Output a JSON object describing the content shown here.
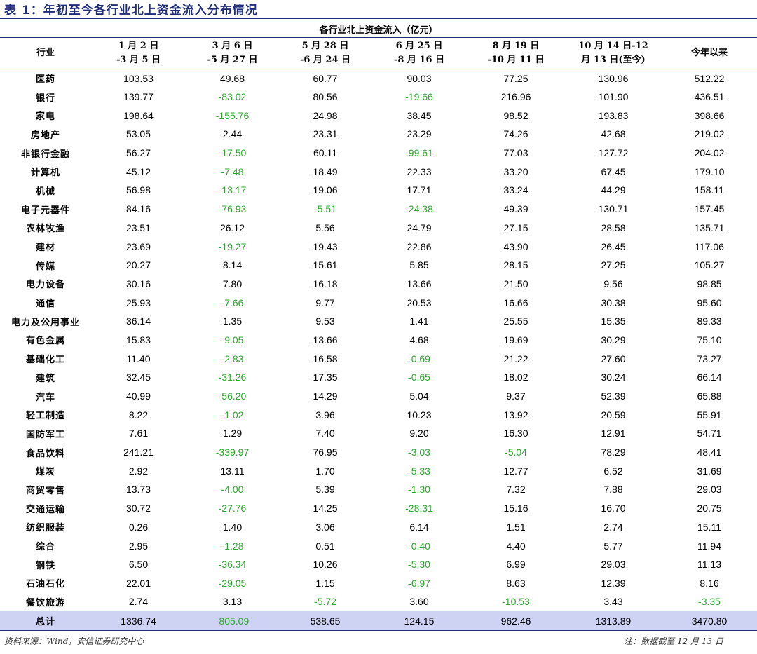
{
  "title": "表 1：年初至今各行业北上资金流入分布情况",
  "super_header": "各行业北上资金流入（亿元）",
  "columns": [
    "行业",
    "1 月 2 日\n-3 月 5 日",
    "3 月 6 日\n-5 月 27 日",
    "5 月 28 日\n-6 月 24 日",
    "6 月 25 日\n-8 月 16 日",
    "8 月 19 日\n-10 月 11 日",
    "10 月 14 日-12\n月 13 日(至今)",
    "今年以来"
  ],
  "rows": [
    [
      "医药",
      "103.53",
      "49.68",
      "60.77",
      "90.03",
      "77.25",
      "130.96",
      "512.22"
    ],
    [
      "银行",
      "139.77",
      "-83.02",
      "80.56",
      "-19.66",
      "216.96",
      "101.90",
      "436.51"
    ],
    [
      "家电",
      "198.64",
      "-155.76",
      "24.98",
      "38.45",
      "98.52",
      "193.83",
      "398.66"
    ],
    [
      "房地产",
      "53.05",
      "2.44",
      "23.31",
      "23.29",
      "74.26",
      "42.68",
      "219.02"
    ],
    [
      "非银行金融",
      "56.27",
      "-17.50",
      "60.11",
      "-99.61",
      "77.03",
      "127.72",
      "204.02"
    ],
    [
      "计算机",
      "45.12",
      "-7.48",
      "18.49",
      "22.33",
      "33.20",
      "67.45",
      "179.10"
    ],
    [
      "机械",
      "56.98",
      "-13.17",
      "19.06",
      "17.71",
      "33.24",
      "44.29",
      "158.11"
    ],
    [
      "电子元器件",
      "84.16",
      "-76.93",
      "-5.51",
      "-24.38",
      "49.39",
      "130.71",
      "157.45"
    ],
    [
      "农林牧渔",
      "23.51",
      "26.12",
      "5.56",
      "24.79",
      "27.15",
      "28.58",
      "135.71"
    ],
    [
      "建材",
      "23.69",
      "-19.27",
      "19.43",
      "22.86",
      "43.90",
      "26.45",
      "117.06"
    ],
    [
      "传媒",
      "20.27",
      "8.14",
      "15.61",
      "5.85",
      "28.15",
      "27.25",
      "105.27"
    ],
    [
      "电力设备",
      "30.16",
      "7.80",
      "16.18",
      "13.66",
      "21.50",
      "9.56",
      "98.85"
    ],
    [
      "通信",
      "25.93",
      "-7.66",
      "9.77",
      "20.53",
      "16.66",
      "30.38",
      "95.60"
    ],
    [
      "电力及公用事业",
      "36.14",
      "1.35",
      "9.53",
      "1.41",
      "25.55",
      "15.35",
      "89.33"
    ],
    [
      "有色金属",
      "15.83",
      "-9.05",
      "13.66",
      "4.68",
      "19.69",
      "30.29",
      "75.10"
    ],
    [
      "基础化工",
      "11.40",
      "-2.83",
      "16.58",
      "-0.69",
      "21.22",
      "27.60",
      "73.27"
    ],
    [
      "建筑",
      "32.45",
      "-31.26",
      "17.35",
      "-0.65",
      "18.02",
      "30.24",
      "66.14"
    ],
    [
      "汽车",
      "40.99",
      "-56.20",
      "14.29",
      "5.04",
      "9.37",
      "52.39",
      "65.88"
    ],
    [
      "轻工制造",
      "8.22",
      "-1.02",
      "3.96",
      "10.23",
      "13.92",
      "20.59",
      "55.91"
    ],
    [
      "国防军工",
      "7.61",
      "1.29",
      "7.40",
      "9.20",
      "16.30",
      "12.91",
      "54.71"
    ],
    [
      "食品饮料",
      "241.21",
      "-339.97",
      "76.95",
      "-3.03",
      "-5.04",
      "78.29",
      "48.41"
    ],
    [
      "煤炭",
      "2.92",
      "13.11",
      "1.70",
      "-5.33",
      "12.77",
      "6.52",
      "31.69"
    ],
    [
      "商贸零售",
      "13.73",
      "-4.00",
      "5.39",
      "-1.30",
      "7.32",
      "7.88",
      "29.03"
    ],
    [
      "交通运输",
      "30.72",
      "-27.76",
      "14.25",
      "-28.31",
      "15.16",
      "16.70",
      "20.75"
    ],
    [
      "纺织服装",
      "0.26",
      "1.40",
      "3.06",
      "6.14",
      "1.51",
      "2.74",
      "15.11"
    ],
    [
      "综合",
      "2.95",
      "-1.28",
      "0.51",
      "-0.40",
      "4.40",
      "5.77",
      "11.94"
    ],
    [
      "钢铁",
      "6.50",
      "-36.34",
      "10.26",
      "-5.30",
      "6.99",
      "29.03",
      "11.13"
    ],
    [
      "石油石化",
      "22.01",
      "-29.05",
      "1.15",
      "-6.97",
      "8.63",
      "12.39",
      "8.16"
    ],
    [
      "餐饮旅游",
      "2.74",
      "3.13",
      "-5.72",
      "3.60",
      "-10.53",
      "3.43",
      "-3.35"
    ]
  ],
  "total": [
    "总计",
    "1336.74",
    "-805.09",
    "538.65",
    "124.15",
    "962.46",
    "1313.89",
    "3470.80"
  ],
  "colors": {
    "accent": "#1f2d7a",
    "negative": "#2da82d",
    "total_bg": "#cfd3f3"
  },
  "source": "资料来源：Wind，安信证券研究中心",
  "note": "注：数据截至 12 月 13 日"
}
